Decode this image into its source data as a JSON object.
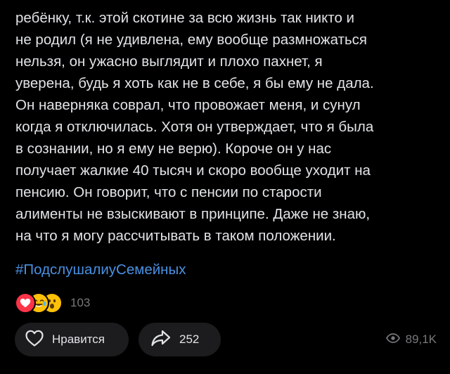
{
  "post": {
    "text_lines": [
      "ребёнку, т.к. этой скотине за всю жизнь так никто и",
      "не родил (я не удивлена, ему вообще размножаться",
      "нельзя, он ужасно выглядит и плохо пахнет, я",
      "уверена, будь я хоть как не в себе, я бы ему не дала.",
      "Он наверняка соврал, что провожает меня, и сунул",
      "когда я отключилась. Хотя он утверждает, что я была",
      "в сознании, но я ему не верю). Короче он у нас",
      "получает жалкие 40 тысяч и скоро вообще уходит на",
      "пенсию. Он говорит, что с пенсии по старости",
      "алименты не взыскивают в принципе. Даже не знаю,",
      "на что я могу рассчитывать в таком положении."
    ],
    "hashtag": "#ПодслушалиуСемейных"
  },
  "reactions": {
    "icons": [
      "heart-reaction",
      "tears-of-joy-reaction",
      "astonished-reaction"
    ],
    "count": "103"
  },
  "actions": {
    "like_label": "Нравится",
    "share_count": "252",
    "views_count": "89,1K"
  },
  "colors": {
    "background": "#000000",
    "text": "#e1e3e6",
    "hashtag": "#4a90e2",
    "muted": "#76787a",
    "button_bg": "#1c1c1e",
    "heart": "#ff3347",
    "emoji": "#ffc107"
  }
}
